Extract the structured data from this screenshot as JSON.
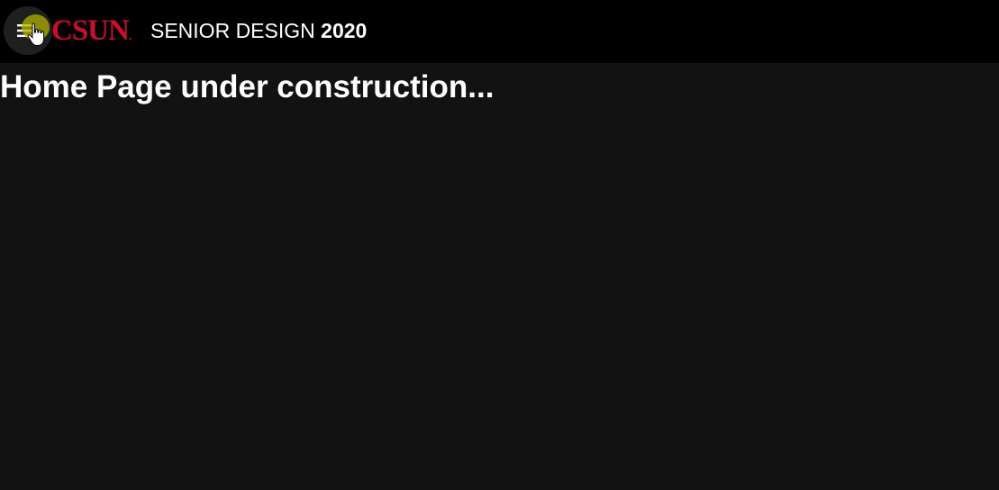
{
  "header": {
    "menu_icon": "menu-icon",
    "logo": {
      "text": "CSUN",
      "dot": ".",
      "color": "#c8102e"
    },
    "title_main": "SENIOR DESIGN ",
    "title_year": "2020"
  },
  "main": {
    "heading": "Home Page under construction..."
  },
  "colors": {
    "topbar": "#000000",
    "background": "#121212",
    "text": "#ffffff",
    "cursor_highlight": "#b2b200"
  }
}
